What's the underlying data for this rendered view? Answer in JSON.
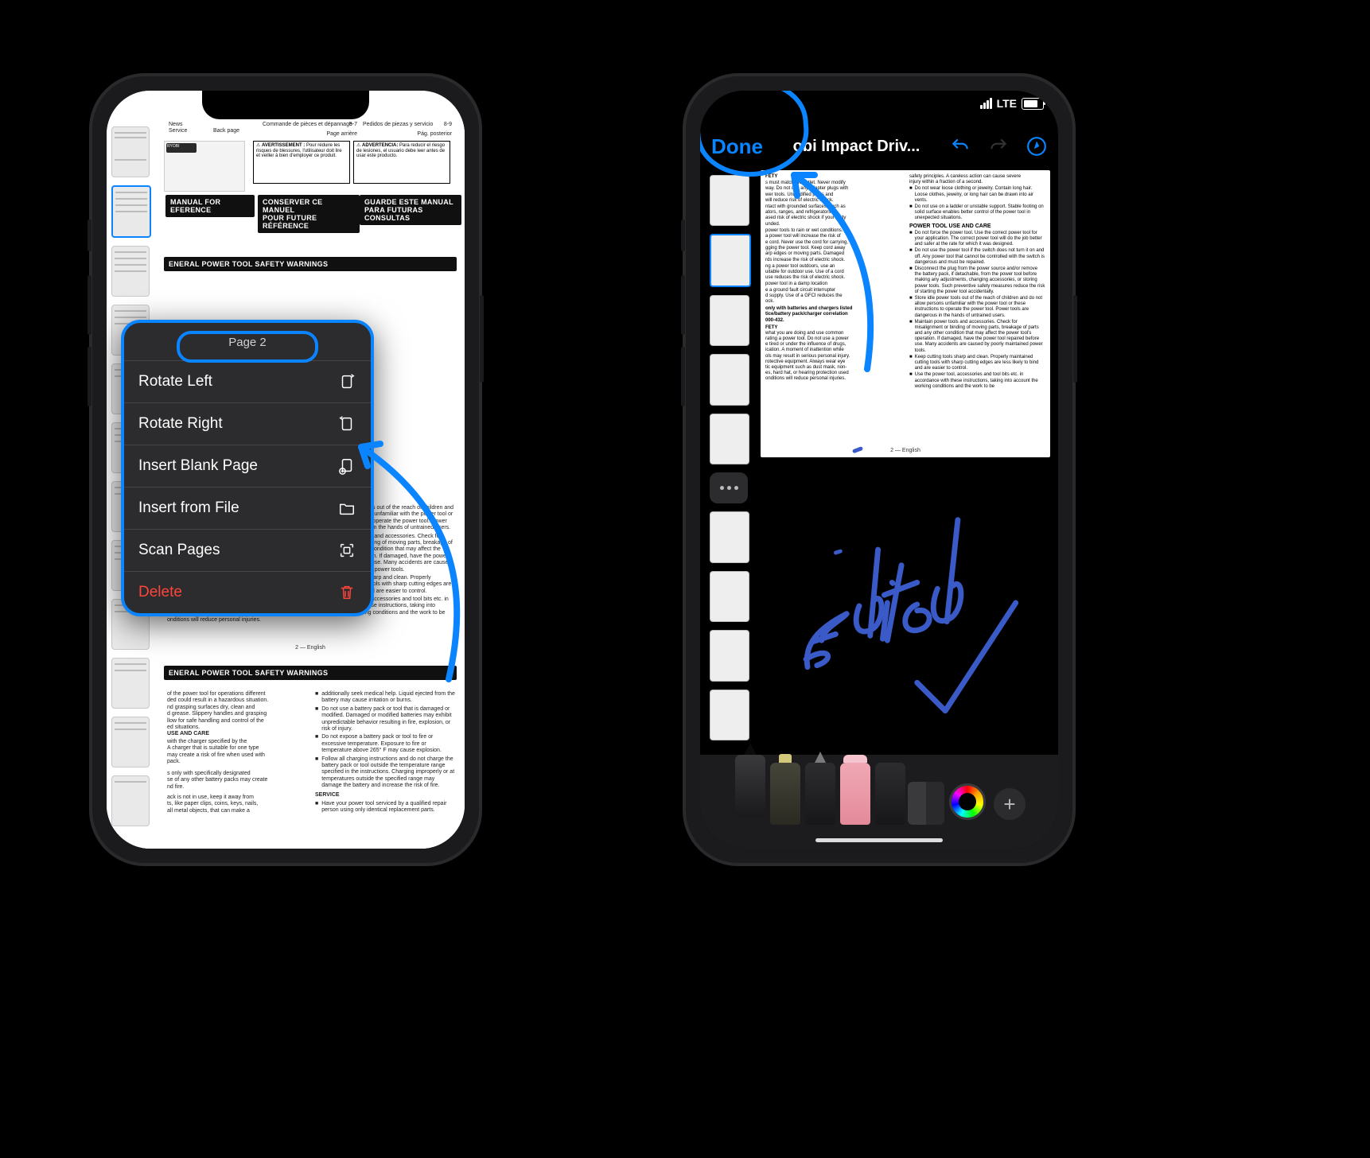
{
  "left": {
    "menu_title": "Page 2",
    "items": {
      "rotate_left": "Rotate Left",
      "rotate_right": "Rotate Right",
      "insert_blank": "Insert Blank Page",
      "insert_file": "Insert from File",
      "scan_pages": "Scan Pages",
      "delete": "Delete"
    },
    "doc": {
      "warnings_header": "ENERAL POWER TOOL SAFETY WARNINGS",
      "keep_box_1": "MANUAL FOR\nEFERENCE",
      "keep_box_2": "CONSERVER CE MANUEL\nPOUR FUTURE RÉFÉRENCE",
      "keep_box_3": "GUARDE ESTE MANUAL\nPARA FUTURAS CONSULTAS",
      "avert": "AVERTISSEMENT :",
      "advert": "ADVERTENCIA:",
      "foot": "2 — English",
      "top_back": "Back page",
      "top_news": "News",
      "top_service": "Service",
      "top_nums1": "5-7",
      "top_nums2": "8-9",
      "page_post": "Pág. posterior",
      "page_arr": "Page arrière",
      "page_nums": "5-7",
      "fr_parts": "Commande de pièces et dépannage",
      "es_parts": "Pedidos de piezas y servicio",
      "gf": "e a ground fault circuit interrupter\nd supply. Use of a GFCI reduces the\nock.",
      "batt": "only with batteries and chargers listed\ntice/battery pack/charger correlation\n000-432.",
      "safety": "FETY",
      "safety_p": "what you are doing and use common\nrating a power tool. Do not use a power\ne tired or under the influence of drugs,\nication. A moment of inattention while\nols may result in serious personal injury.\nrotective equipment. Always wear eye\ntic equipment such as dust mask, non-\nes, hard hat, or hearing protection used\nonditions will reduce personal injuries.",
      "bullets": [
        "Store idle power tools out of the reach of children and do not allow persons unfamiliar with the power tool or these instructions to operate the power tool. Power tools are dangerous in the hands of untrained users.",
        "Maintain power tools and accessories. Check for misalignment or binding of moving parts, breakage of parts and any other condition that may affect the power tool's operation. If damaged, have the power tool repaired before use. Many accidents are caused by poorly maintained power tools.",
        "Keep cutting tools sharp and clean. Properly maintained cutting tools with sharp cutting edges are less likely to bind and are easier to control.",
        "Use the power tool, accessories and tool bits etc. in accordance with these instructions, taking into account the working conditions and the work to be"
      ],
      "lower_left_head": "USE AND CARE",
      "lower_left": "of the power tool for operations different\nded could result in a hazardous situation.\nnd grasping surfaces dry, clean and\nd grease. Slippery handles and grasping\nllow for safe handling and control of the\ned situations.",
      "charger": "with the charger specified by the\nA charger that is suitable for one type\nmay create a risk of fire when used with\npack.",
      "desig": "s only with specifically designated\nse of any other battery packs may create\nnd fire.",
      "notuse": "ack is not in use, keep it away from\nts, like paper clips, coins, keys, nails,\nall metal objects, that can make a",
      "lower_right": [
        "additionally seek medical help. Liquid ejected from the battery may cause irritation or burns.",
        "Do not use a battery pack or tool that is damaged or modified. Damaged or modified batteries may exhibit unpredictable behavior resulting in fire, explosion, or risk of injury.",
        "Do not expose a battery pack or tool to fire or excessive temperature. Exposure to fire or temperature above 265° F may cause explosion.",
        "Follow all charging instructions and do not charge the battery pack or tool outside the temperature range specified in the instructions. Charging improperly or at temperatures outside the specified range may damage the battery and increase the risk of fire."
      ],
      "service_h": "SERVICE",
      "service_p": "Have your power tool serviced by a qualified repair person using only identical replacement parts."
    }
  },
  "right": {
    "done": "Done",
    "title": "obi Impact Driv...",
    "status_net": "LTE",
    "annotation": "Edited",
    "foot": "2 — English",
    "page_text": {
      "col1": [
        "FETY",
        "s must match the outlet. Never modify\n way. Do not use any adapter plugs with\nwer tools. Unmodified plugs and\nwill reduce risk of electric shock.",
        "ntact with grounded surfaces, such as\nators, ranges, and refrigerators.\nased risk of electric shock if your body\nunded.",
        "power tools to rain or wet conditions.\na power tool will increase the risk of",
        "e cord. Never use the cord for carrying,\ngging the power tool. Keep cord away\narp edges or moving parts. Damaged\nrds increase the risk of electric shock.",
        "ng a power tool outdoors, use an\nuitable for outdoor use. Use of a cord\nuse reduces the risk of electric shock.",
        "power tool in a damp location\ne a ground fault circuit interrupter\nd supply. Use of a GFCI reduces the\nock."
      ],
      "col1_batt": "only with batteries and chargers listed\ntice/battery pack/charger correlation\n000-432.",
      "col1_fety2": "FETY",
      "col1_fety2_p": "what you are doing and use common\nrating a power tool. Do not use a power\ne tired or under the influence of drugs,\nication. A moment of inattention while\nols may result in serious personal injury.\nrotective equipment. Always wear eye\ntic equipment such as dust mask, non-\nes, hard hat, or hearing protection used\nonditions will reduce personal injuries.",
      "col2_top": "safety principles. A careless action can cause severe\ninjury within a fraction of a second.",
      "col2": [
        "Do not wear loose clothing or jewelry. Contain long hair. Loose clothes, jewelry, or long hair can be drawn into air vents.",
        "Do not use on a ladder or unstable support. Stable footing on solid surface enables better control of the power tool in unexpected situations."
      ],
      "col2_head": "POWER TOOL USE AND CARE",
      "col2b": [
        "Do not force the power tool. Use the correct power tool for your application. The correct power tool will do the job better and safer at the rate for which it was designed.",
        "Do not use the power tool if the switch does not turn it on and off. Any power tool that cannot be controlled with the switch is dangerous and must be repaired.",
        "Disconnect the plug from the power source and/or remove the battery pack, if detachable, from the power tool before making any adjustments, changing accessories, or storing power tools. Such preventive safety measures reduce the risk of starting the power tool accidentally.",
        "Store idle power tools out of the reach of children and do not allow persons unfamiliar with the power tool or these instructions to operate the power tool. Power tools are dangerous in the hands of untrained users.",
        "Maintain power tools and accessories. Check for misalignment or binding of moving parts, breakage of parts and any other condition that may affect the power tool's operation. If damaged, have the power tool repaired before use. Many accidents are caused by poorly maintained power tools.",
        "Keep cutting tools sharp and clean. Properly maintained cutting tools with sharp cutting edges are less likely to bind and are easier to control.",
        "Use the power tool, accessories and tool bits etc. in accordance with these instructions, taking into account the working conditions and the work to be"
      ]
    }
  }
}
